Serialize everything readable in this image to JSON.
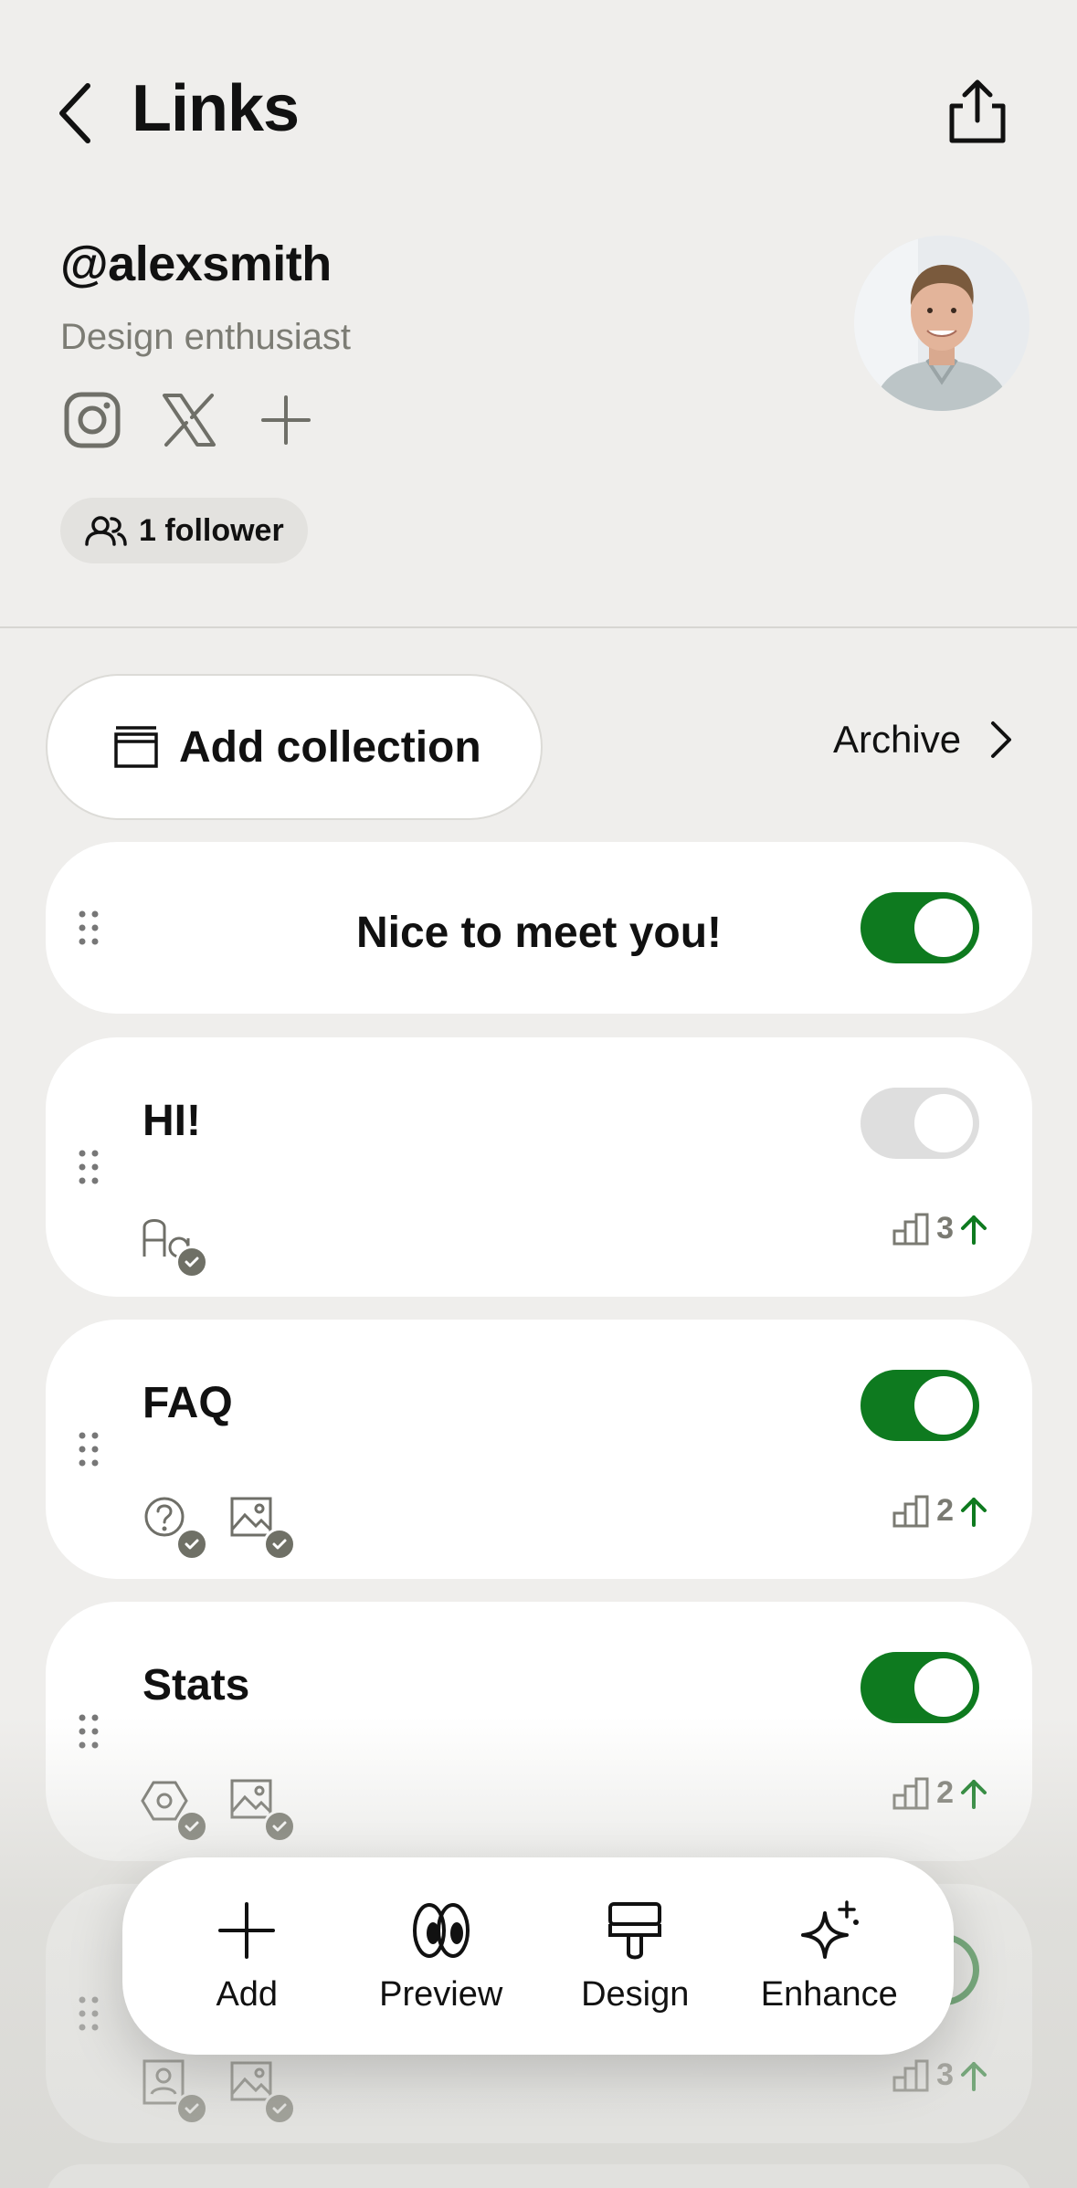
{
  "header": {
    "title": "Links",
    "back_icon": "chevron-left-icon",
    "share_icon": "share-icon"
  },
  "profile": {
    "username": "@alexsmith",
    "bio": "Design enthusiast",
    "socials": [
      "instagram-icon",
      "x-icon",
      "plus-icon"
    ],
    "followers_label": "1 follower"
  },
  "collections": {
    "add_label": "Add collection",
    "archive_label": "Archive"
  },
  "cards": [
    {
      "title": "Nice to meet you!",
      "type": "header",
      "enabled": true
    },
    {
      "title": "HI!",
      "enabled": false,
      "features": [
        "text-style-icon"
      ],
      "stat": "3"
    },
    {
      "title": "FAQ",
      "enabled": true,
      "features": [
        "question-icon",
        "image-icon"
      ],
      "stat": "2"
    },
    {
      "title": "Stats",
      "enabled": true,
      "features": [
        "hexagon-icon",
        "image-icon"
      ],
      "stat": "2"
    },
    {
      "title": "",
      "enabled": true,
      "features": [
        "profile-card-icon",
        "image-icon"
      ],
      "stat": "3"
    }
  ],
  "toolbar": {
    "items": [
      {
        "label": "Add",
        "icon": "plus-icon"
      },
      {
        "label": "Preview",
        "icon": "eyes-icon"
      },
      {
        "label": "Design",
        "icon": "paintbrush-icon"
      },
      {
        "label": "Enhance",
        "icon": "sparkles-icon"
      }
    ]
  },
  "colors": {
    "background": "#efeeec",
    "accent": "#0e7a1f",
    "card": "#ffffff",
    "muted": "#7c7c74"
  }
}
